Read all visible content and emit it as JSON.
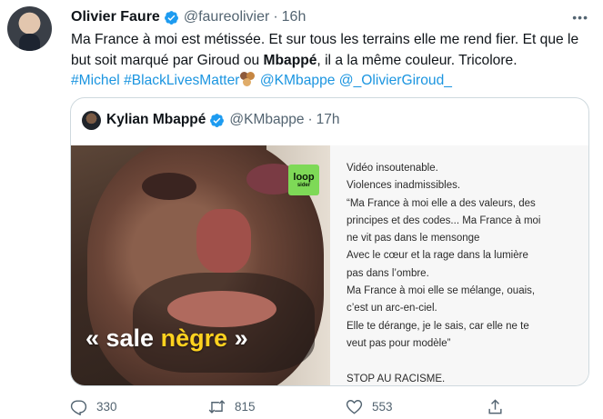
{
  "tweet": {
    "author_name": "Olivier Faure",
    "handle": "@faureolivier",
    "separator": "·",
    "time": "16h",
    "more_label": "•••",
    "text_segments": {
      "part1": "Ma France à moi est métissée. Et sur tous les terrains elle me rend fier. Et que le but soit marqué par Giroud ou ",
      "bold": "Mbappé",
      "part2": ", il a la même couleur. Tricolore.",
      "hashtag1": "#Michel",
      "hashtag2": "#BlackLivesMatter",
      "mention1": "@KMbappe",
      "mention2": "@_OlivierGiroud_"
    }
  },
  "quote": {
    "author_name": "Kylian Mbappé",
    "handle": "@KMbappe",
    "separator": "·",
    "time": "17h",
    "media": {
      "logo_line1": "loop",
      "logo_line2": "sider",
      "caption_open": "« sale ",
      "caption_highlight": "nègre",
      "caption_close": " »"
    },
    "text_lines": [
      "Vidéo insoutenable.",
      "Violences inadmissibles.",
      "“Ma France à moi elle a des valeurs, des",
      "principes et des codes... Ma France à moi",
      "ne vit pas dans le mensonge",
      "Avec le cœur et la rage dans la lumière",
      "pas dans l’ombre.",
      "Ma France à moi elle se mélange, ouais,",
      "c’est un arc-en-ciel.",
      "Elle te dérange, je le sais, car elle ne te",
      "veut pas pour modèle”",
      "",
      "STOP AU RACISME."
    ]
  },
  "actions": {
    "reply_count": "330",
    "retweet_count": "815",
    "like_count": "553"
  },
  "colors": {
    "link": "#1b95e0",
    "verified": "#1d9bf0",
    "muted": "#536471",
    "logo_green": "#7ed957",
    "caption_yellow": "#ffd21f"
  },
  "icons": {
    "verified": "verified-badge-icon",
    "reply": "reply-icon",
    "retweet": "retweet-icon",
    "like": "heart-icon",
    "share": "share-icon",
    "more": "more-icon"
  }
}
